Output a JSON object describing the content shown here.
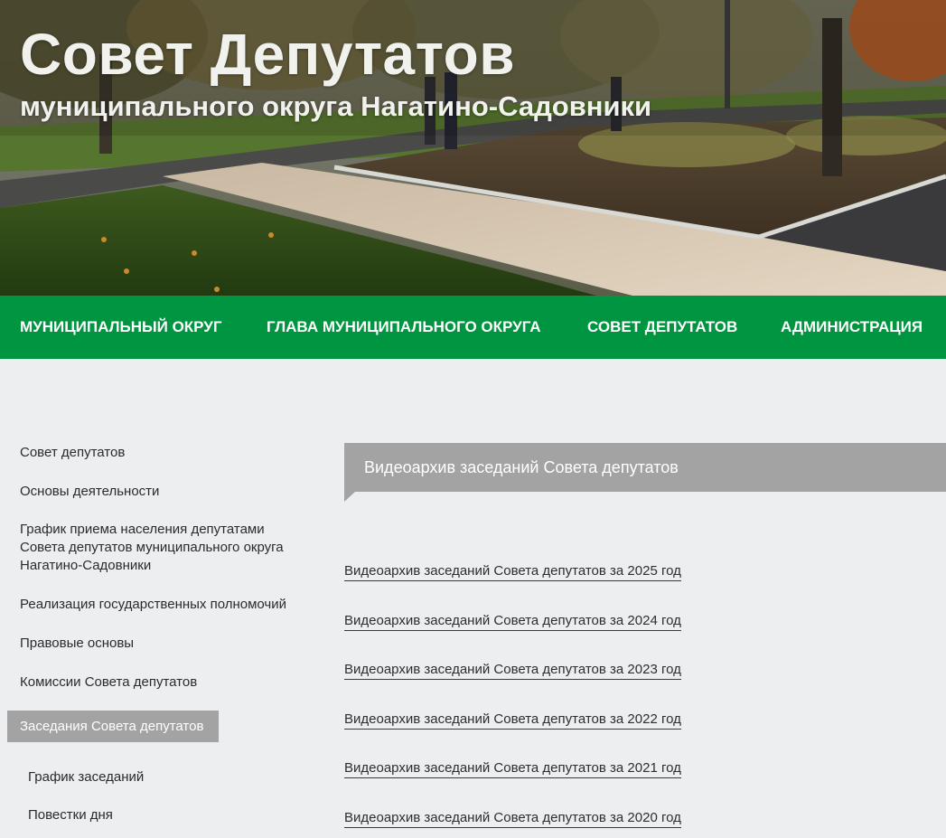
{
  "header": {
    "title": "Совет Депутатов",
    "subtitle": "муниципального округа Нагатино-Садовники"
  },
  "nav": {
    "items": [
      {
        "label": "МУНИЦИПАЛЬНЫЙ ОКРУГ"
      },
      {
        "label": "ГЛАВА МУНИЦИПАЛЬНОГО ОКРУГА"
      },
      {
        "label": "СОВЕТ ДЕПУТАТОВ"
      },
      {
        "label": "АДМИНИСТРАЦИЯ"
      }
    ]
  },
  "sidebar": {
    "items": [
      {
        "label": "Совет депутатов"
      },
      {
        "label": "Основы деятельности"
      },
      {
        "label": "График приема населения депутатами Совета депутатов муниципального округа Нагатино-Садовники"
      },
      {
        "label": "Реализация государственных полномочий"
      },
      {
        "label": "Правовые основы"
      },
      {
        "label": "Комиссии Совета депутатов"
      },
      {
        "label": "Заседания Совета депутатов",
        "active": true
      }
    ],
    "subitems": [
      {
        "label": "График заседаний"
      },
      {
        "label": "Повестки дня"
      }
    ]
  },
  "content": {
    "heading": "Видеоархив заседаний Совета депутатов",
    "links": [
      {
        "label": "Видеоархив заседаний Совета депутатов за 2025 год"
      },
      {
        "label": "Видеоархив заседаний Совета депутатов за 2024 год"
      },
      {
        "label": "Видеоархив заседаний Совета депутатов за 2023 год"
      },
      {
        "label": "Видеоархив заседаний Совета депутатов за 2022 год"
      },
      {
        "label": "Видеоархив заседаний Совета депутатов за 2021 год"
      },
      {
        "label": "Видеоархив заседаний Совета депутатов за 2020 год"
      }
    ]
  },
  "colors": {
    "nav_green": "#009540",
    "page_bg": "#eceeef",
    "active_gray": "#a3a3a3"
  }
}
